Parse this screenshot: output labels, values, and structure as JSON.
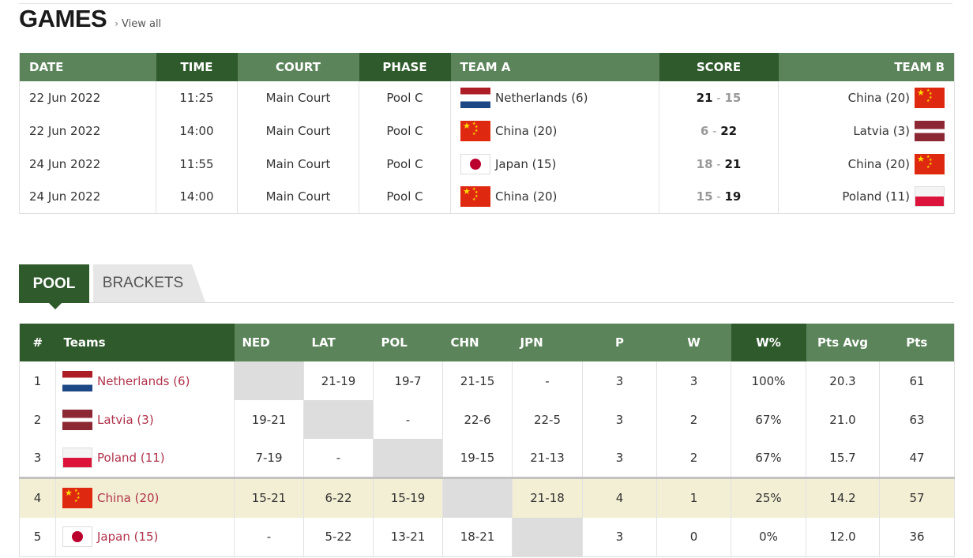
{
  "games": {
    "title": "GAMES",
    "view_all": "View all",
    "columns": [
      "DATE",
      "TIME",
      "COURT",
      "PHASE",
      "TEAM A",
      "SCORE",
      "TEAM B"
    ],
    "rows": [
      {
        "date": "22 Jun 2022",
        "time": "11:25",
        "court": "Main Court",
        "phase": "Pool C",
        "team_a": "Netherlands (6)",
        "flag_a": "ned",
        "score_a": "21",
        "score_b": "15",
        "team_b": "China (20)",
        "flag_b": "chn"
      },
      {
        "date": "22 Jun 2022",
        "time": "14:00",
        "court": "Main Court",
        "phase": "Pool C",
        "team_a": "China (20)",
        "flag_a": "chn",
        "score_a": "6",
        "score_b": "22",
        "team_b": "Latvia (3)",
        "flag_b": "lat"
      },
      {
        "date": "24 Jun 2022",
        "time": "11:55",
        "court": "Main Court",
        "phase": "Pool C",
        "team_a": "Japan (15)",
        "flag_a": "jpn",
        "score_a": "18",
        "score_b": "21",
        "team_b": "China (20)",
        "flag_b": "chn"
      },
      {
        "date": "24 Jun 2022",
        "time": "14:00",
        "court": "Main Court",
        "phase": "Pool C",
        "team_a": "China (20)",
        "flag_a": "chn",
        "score_a": "15",
        "score_b": "19",
        "team_b": "Poland (11)",
        "flag_b": "pol"
      }
    ]
  },
  "tabs": {
    "pool": "POOL",
    "brackets": "BRACKETS"
  },
  "pool": {
    "columns": [
      "#",
      "Teams",
      "NED",
      "LAT",
      "POL",
      "CHN",
      "JPN",
      "P",
      "W",
      "W%",
      "Pts Avg",
      "Pts"
    ],
    "rows": [
      {
        "rank": "1",
        "team": "Netherlands (6)",
        "flag": "ned",
        "results": [
          "",
          "21-19",
          "19-7",
          "21-15",
          "-"
        ],
        "p": "3",
        "w": "3",
        "wpct": "100%",
        "avg": "20.3",
        "pts": "61"
      },
      {
        "rank": "2",
        "team": "Latvia (3)",
        "flag": "lat",
        "results": [
          "19-21",
          "",
          "-",
          "22-6",
          "22-5"
        ],
        "p": "3",
        "w": "2",
        "wpct": "67%",
        "avg": "21.0",
        "pts": "63"
      },
      {
        "rank": "3",
        "team": "Poland (11)",
        "flag": "pol",
        "results": [
          "7-19",
          "-",
          "",
          "19-15",
          "21-13"
        ],
        "p": "3",
        "w": "2",
        "wpct": "67%",
        "avg": "15.7",
        "pts": "47"
      },
      {
        "rank": "4",
        "team": "China (20)",
        "flag": "chn",
        "results": [
          "15-21",
          "6-22",
          "15-19",
          "",
          "21-18"
        ],
        "p": "4",
        "w": "1",
        "wpct": "25%",
        "avg": "14.2",
        "pts": "57"
      },
      {
        "rank": "5",
        "team": "Japan (15)",
        "flag": "jpn",
        "results": [
          "-",
          "5-22",
          "13-21",
          "18-21",
          ""
        ],
        "p": "3",
        "w": "0",
        "wpct": "0%",
        "avg": "12.0",
        "pts": "36"
      }
    ]
  },
  "colors": {
    "header_dark": "#2f5a2c",
    "header_light": "#5b845a",
    "team_link": "#b0334b",
    "highlight_row": "#f3efd4"
  }
}
